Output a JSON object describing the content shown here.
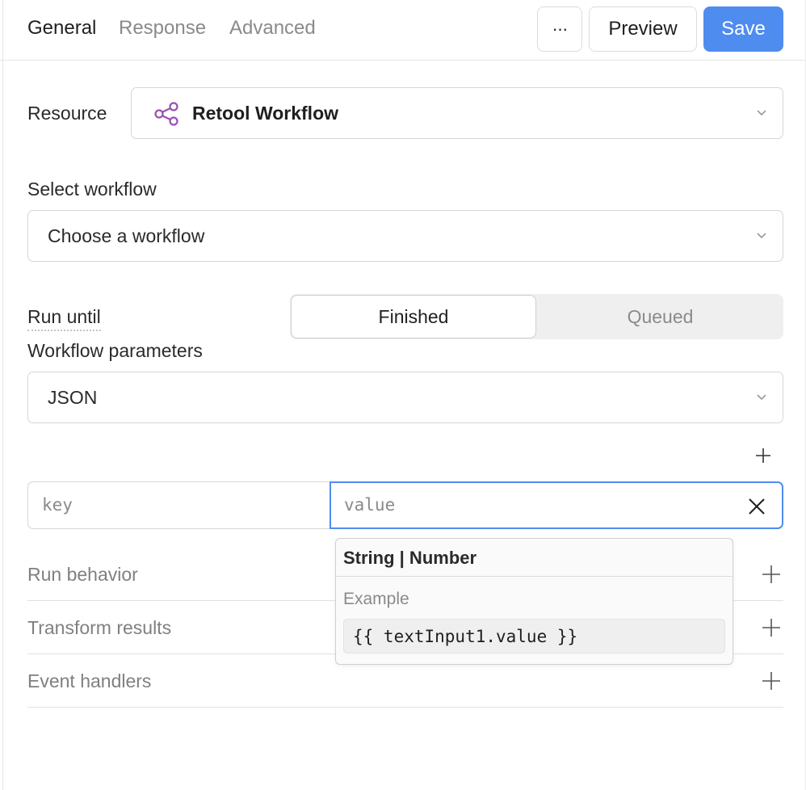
{
  "tabs": [
    {
      "label": "General",
      "active": true
    },
    {
      "label": "Response",
      "active": false
    },
    {
      "label": "Advanced",
      "active": false
    }
  ],
  "toolbar": {
    "more_label": "···",
    "preview_label": "Preview",
    "save_label": "Save"
  },
  "resource": {
    "label": "Resource",
    "value": "Retool Workflow",
    "icon": "share-nodes-icon"
  },
  "select_workflow": {
    "label": "Select workflow",
    "placeholder": "Choose a workflow"
  },
  "run_until": {
    "label": "Run until",
    "options": [
      "Finished",
      "Queued"
    ],
    "selected": "Finished"
  },
  "workflow_parameters": {
    "label": "Workflow parameters",
    "value": "JSON"
  },
  "kv": {
    "key_placeholder": "key",
    "value_placeholder": "value"
  },
  "tooltip": {
    "type_text": "String | Number",
    "example_label": "Example",
    "example_code": "{{ textInput1.value }}"
  },
  "sections": [
    {
      "title": "Run behavior"
    },
    {
      "title": "Transform results"
    },
    {
      "title": "Event handlers"
    }
  ],
  "colors": {
    "accent": "#4f8cf0",
    "resource_icon": "#9b4fb4"
  }
}
